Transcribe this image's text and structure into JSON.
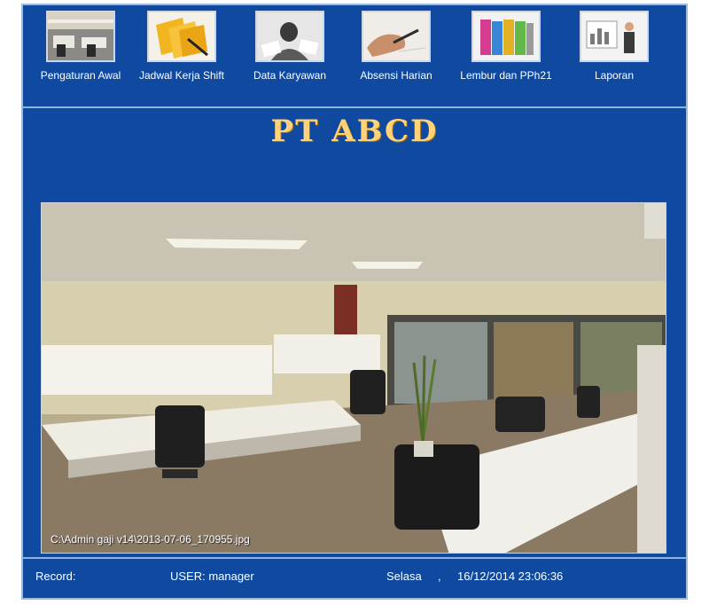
{
  "company": {
    "name": "PT ABCD"
  },
  "toolbar": {
    "items": [
      {
        "label": "Pengaturan Awal",
        "icon": "office-room-icon"
      },
      {
        "label": "Jadwal Kerja Shift",
        "icon": "folders-icon"
      },
      {
        "label": "Data Karyawan",
        "icon": "employee-data-icon"
      },
      {
        "label": "Absensi Harian",
        "icon": "writing-hand-icon"
      },
      {
        "label": "Lembur dan PPh21",
        "icon": "binders-icon"
      },
      {
        "label": "Laporan",
        "icon": "presentation-icon"
      }
    ]
  },
  "main": {
    "photo_caption": "C:\\Admin gaji v14\\2013-07-06_170955.jpg"
  },
  "status": {
    "record_label": "Record:",
    "user": "USER: manager",
    "day": "Selasa",
    "separator": ",",
    "datetime": "16/12/2014 23:06:36"
  },
  "colors": {
    "background": "#0f4aa0",
    "title": "#ffd37a",
    "border": "#8fb2e0"
  }
}
